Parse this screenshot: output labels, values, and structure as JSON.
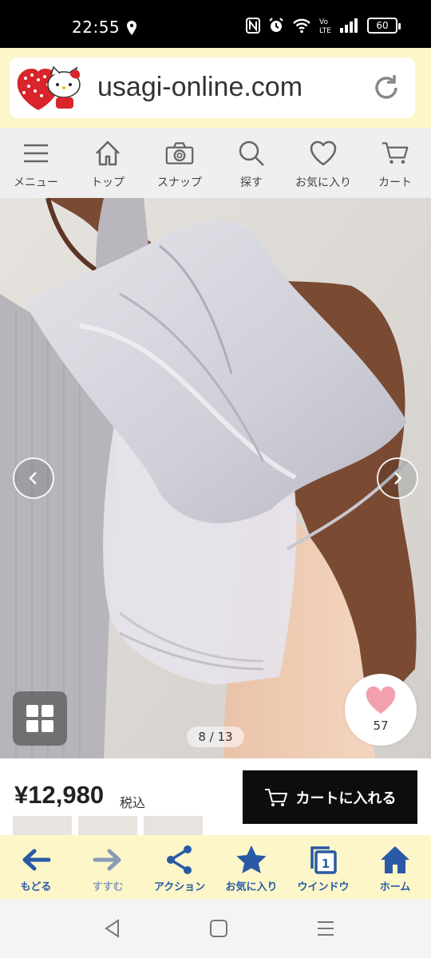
{
  "status_bar": {
    "time": "22:55",
    "battery": "60",
    "icons": [
      "location-icon",
      "nfc-icon",
      "alarm-icon",
      "wifi-icon",
      "volte-icon",
      "signal-icon",
      "battery-icon"
    ]
  },
  "browser": {
    "url": "usagi-online.com",
    "logo_icon": "hello-kitty-logo",
    "reload_icon": "reload-icon"
  },
  "nav": {
    "items": [
      {
        "label": "メニュー",
        "icon": "menu-icon"
      },
      {
        "label": "トップ",
        "icon": "home-icon"
      },
      {
        "label": "スナップ",
        "icon": "camera-icon"
      },
      {
        "label": "探す",
        "icon": "search-icon"
      },
      {
        "label": "お気に入り",
        "icon": "heart-icon"
      },
      {
        "label": "カート",
        "icon": "cart-icon"
      }
    ]
  },
  "gallery": {
    "page_indicator": "8 / 13",
    "current_page": 8,
    "total_pages": 13,
    "favorite_count": "57",
    "accent_heart": "#f2a0ad"
  },
  "product": {
    "price": "¥12,980",
    "tax_label": "税込",
    "cart_button_label": "カートに入れる"
  },
  "toolbar": {
    "items": [
      {
        "label": "もどる",
        "icon": "back-arrow-icon",
        "enabled": true
      },
      {
        "label": "すすむ",
        "icon": "forward-arrow-icon",
        "enabled": false
      },
      {
        "label": "アクション",
        "icon": "share-icon",
        "enabled": true
      },
      {
        "label": "お気に入り",
        "icon": "star-icon",
        "enabled": true
      },
      {
        "label": "ウインドウ",
        "icon": "window-icon",
        "enabled": true,
        "badge": "1"
      },
      {
        "label": "ホーム",
        "icon": "home-icon",
        "enabled": true
      }
    ]
  },
  "colors": {
    "toolbar_bg": "#fdf6c9",
    "toolbar_blue": "#2a5aa6",
    "cart_button_bg": "#0d0d0d"
  }
}
